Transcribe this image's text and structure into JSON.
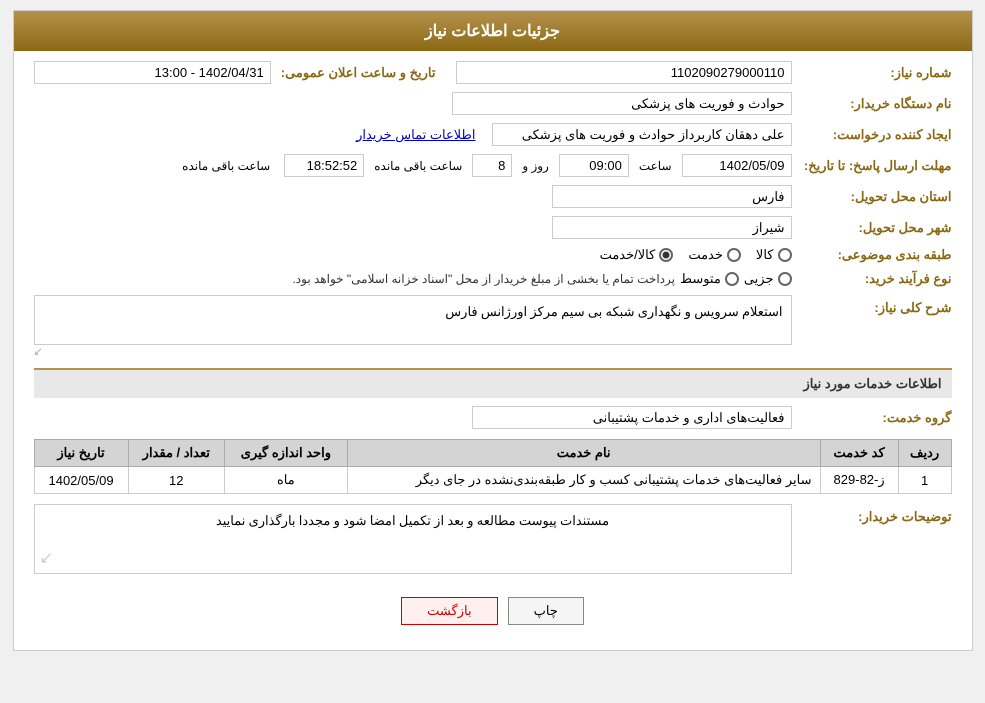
{
  "page": {
    "title": "جزئیات اطلاعات نیاز"
  },
  "header": {
    "title": "جزئیات اطلاعات نیاز"
  },
  "fields": {
    "need_number_label": "شماره نیاز:",
    "need_number_value": "1102090279000110",
    "announcement_label": "تاریخ و ساعت اعلان عمومی:",
    "announcement_value": "1402/04/31 - 13:00",
    "buyer_station_label": "نام دستگاه خریدار:",
    "buyer_station_value": "حوادث و فوریت های پزشکی",
    "creator_label": "ایجاد کننده درخواست:",
    "creator_value": "علی دهقان کاربرداز حوادث و فوریت های پزشکی",
    "contact_link": "اطلاعات تماس خریدار",
    "response_deadline_label": "مهلت ارسال پاسخ: تا تاریخ:",
    "response_date": "1402/05/09",
    "response_time_label": "ساعت",
    "response_time": "09:00",
    "response_days_label": "روز و",
    "response_days": "8",
    "response_remaining_label": "ساعت باقی مانده",
    "response_remaining": "18:52:52",
    "delivery_province_label": "استان محل تحویل:",
    "delivery_province_value": "فارس",
    "delivery_city_label": "شهر محل تحویل:",
    "delivery_city_value": "شیراز",
    "category_label": "طبقه بندی موضوعی:",
    "category_options": [
      "کالا",
      "خدمت",
      "کالا/خدمت"
    ],
    "category_selected": "کالا/خدمت",
    "process_label": "نوع فرآیند خرید:",
    "process_options": [
      "جزیی",
      "متوسط"
    ],
    "process_note": "پرداخت تمام یا بخشی از مبلغ خریدار از محل \"اسناد خزانه اسلامی\" خواهد بود.",
    "general_description_label": "شرح کلی نیاز:",
    "general_description_value": "استعلام سرویس و نگهداری شبکه بی سیم مرکز اورژانس فارس",
    "services_section_label": "اطلاعات خدمات مورد نیاز",
    "service_group_label": "گروه خدمت:",
    "service_group_value": "فعالیت‌های اداری و خدمات پشتیبانی",
    "table": {
      "headers": [
        "ردیف",
        "کد خدمت",
        "نام خدمت",
        "واحد اندازه گیری",
        "تعداد / مقدار",
        "تاریخ نیاز"
      ],
      "rows": [
        {
          "row": "1",
          "code": "ز-82-829",
          "name": "سایر فعالیت‌های خدمات پشتیبانی کسب و کار طبقه‌بندی‌نشده در جای دیگر",
          "unit": "ماه",
          "quantity": "12",
          "date": "1402/05/09"
        }
      ]
    },
    "buyer_notes_label": "توضیحات خریدار:",
    "buyer_notes_value": "مستندات پیوست مطالعه و بعد از تکمیل امضا شود و مجددا بارگذاری نمایید"
  },
  "buttons": {
    "print_label": "چاپ",
    "back_label": "بازگشت"
  }
}
